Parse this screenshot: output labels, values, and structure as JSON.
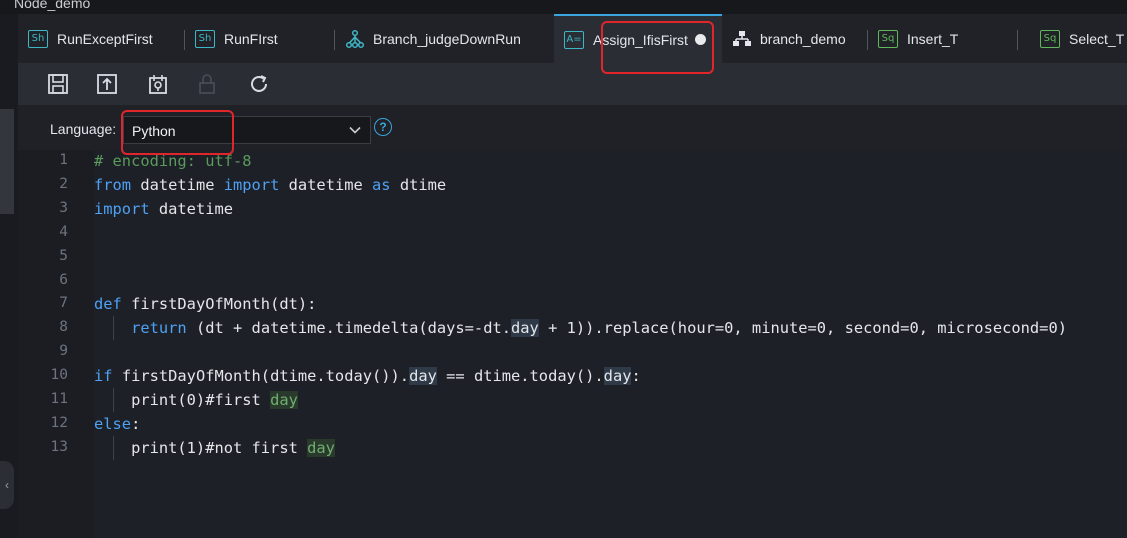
{
  "window": {
    "title": "Node_demo"
  },
  "tabs": [
    {
      "label": "RunExceptFirst",
      "icon": "sh-badge",
      "badge": "Sh"
    },
    {
      "label": "RunFIrst",
      "icon": "sh-badge",
      "badge": "Sh"
    },
    {
      "label": "Branch_judgeDownRun",
      "icon": "branch-icon"
    },
    {
      "label": "Assign_IfisFirst",
      "icon": "assign-badge",
      "badge": "A=",
      "active": true,
      "unsaved": true
    },
    {
      "label": "branch_demo",
      "icon": "hierarchy-icon"
    },
    {
      "label": "Insert_T",
      "icon": "sql-badge",
      "badge": "Sq"
    },
    {
      "label": "Select_T",
      "icon": "sql-badge",
      "badge": "Sq"
    }
  ],
  "toolbar": [
    "save-icon",
    "submit-icon",
    "run-icon",
    "lock-icon",
    "refresh-icon"
  ],
  "language": {
    "label": "Language:",
    "value": "Python",
    "help": "?"
  },
  "editor": {
    "lines": [
      {
        "n": "1",
        "html": "<span class=\"cm\"># encoding: utf-8</span>"
      },
      {
        "n": "2",
        "html": "<span class=\"kw\">from</span> datetime <span class=\"kw\">import</span> datetime <span class=\"kw\">as</span> dtime"
      },
      {
        "n": "3",
        "html": "<span class=\"kw\">import</span> datetime"
      },
      {
        "n": "4",
        "html": ""
      },
      {
        "n": "5",
        "html": ""
      },
      {
        "n": "6",
        "html": ""
      },
      {
        "n": "7",
        "html": "<span class=\"kw\">def</span> firstDayOfMonth(dt):"
      },
      {
        "n": "8",
        "html": "    <span class=\"kw\">return</span> (dt + datetime.timedelta(days=-dt.<span class=\"hl\">day</span> + 1)).replace(hour=0, minute=0, second=0, microsecond=0)"
      },
      {
        "n": "9",
        "html": ""
      },
      {
        "n": "10",
        "html": "<span class=\"kw\">if</span> firstDayOfMonth(dtime.today()).<span class=\"hl\">day</span> == dtime.today().<span class=\"hl\">day</span>:"
      },
      {
        "n": "11",
        "html": "    print(0)#first <span class=\"hlg\">day</span>"
      },
      {
        "n": "12",
        "html": "<span class=\"kw\">else</span>:"
      },
      {
        "n": "13",
        "html": "    print(1)#not first <span class=\"hlg\">day</span>"
      }
    ]
  },
  "colors": {
    "accent": "#3aa4dd",
    "annotation": "#e0262a",
    "keyword": "#4ea1f3",
    "comment": "#5a9a5a"
  }
}
